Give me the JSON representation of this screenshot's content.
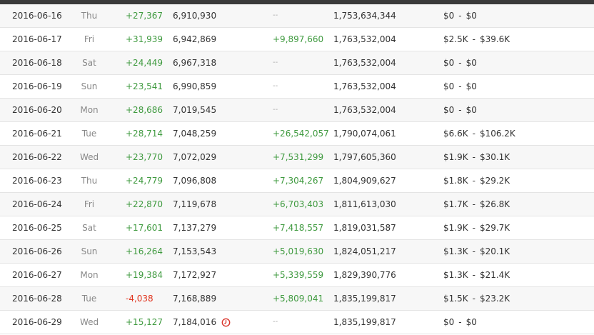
{
  "rows": [
    {
      "date": "2016-06-16",
      "day": "Thu",
      "sub_change": "+27,367",
      "sub_dir": "pos",
      "subs": "6,910,930",
      "warn": false,
      "view_change": "--",
      "view_dir": "none",
      "views": "1,753,634,344",
      "earnings_low": "$0",
      "earnings_high": "$0"
    },
    {
      "date": "2016-06-17",
      "day": "Fri",
      "sub_change": "+31,939",
      "sub_dir": "pos",
      "subs": "6,942,869",
      "warn": false,
      "view_change": "+9,897,660",
      "view_dir": "pos",
      "views": "1,763,532,004",
      "earnings_low": "$2.5K",
      "earnings_high": "$39.6K"
    },
    {
      "date": "2016-06-18",
      "day": "Sat",
      "sub_change": "+24,449",
      "sub_dir": "pos",
      "subs": "6,967,318",
      "warn": false,
      "view_change": "--",
      "view_dir": "none",
      "views": "1,763,532,004",
      "earnings_low": "$0",
      "earnings_high": "$0"
    },
    {
      "date": "2016-06-19",
      "day": "Sun",
      "sub_change": "+23,541",
      "sub_dir": "pos",
      "subs": "6,990,859",
      "warn": false,
      "view_change": "--",
      "view_dir": "none",
      "views": "1,763,532,004",
      "earnings_low": "$0",
      "earnings_high": "$0"
    },
    {
      "date": "2016-06-20",
      "day": "Mon",
      "sub_change": "+28,686",
      "sub_dir": "pos",
      "subs": "7,019,545",
      "warn": false,
      "view_change": "--",
      "view_dir": "none",
      "views": "1,763,532,004",
      "earnings_low": "$0",
      "earnings_high": "$0"
    },
    {
      "date": "2016-06-21",
      "day": "Tue",
      "sub_change": "+28,714",
      "sub_dir": "pos",
      "subs": "7,048,259",
      "warn": false,
      "view_change": "+26,542,057",
      "view_dir": "pos",
      "views": "1,790,074,061",
      "earnings_low": "$6.6K",
      "earnings_high": "$106.2K"
    },
    {
      "date": "2016-06-22",
      "day": "Wed",
      "sub_change": "+23,770",
      "sub_dir": "pos",
      "subs": "7,072,029",
      "warn": false,
      "view_change": "+7,531,299",
      "view_dir": "pos",
      "views": "1,797,605,360",
      "earnings_low": "$1.9K",
      "earnings_high": "$30.1K"
    },
    {
      "date": "2016-06-23",
      "day": "Thu",
      "sub_change": "+24,779",
      "sub_dir": "pos",
      "subs": "7,096,808",
      "warn": false,
      "view_change": "+7,304,267",
      "view_dir": "pos",
      "views": "1,804,909,627",
      "earnings_low": "$1.8K",
      "earnings_high": "$29.2K"
    },
    {
      "date": "2016-06-24",
      "day": "Fri",
      "sub_change": "+22,870",
      "sub_dir": "pos",
      "subs": "7,119,678",
      "warn": false,
      "view_change": "+6,703,403",
      "view_dir": "pos",
      "views": "1,811,613,030",
      "earnings_low": "$1.7K",
      "earnings_high": "$26.8K"
    },
    {
      "date": "2016-06-25",
      "day": "Sat",
      "sub_change": "+17,601",
      "sub_dir": "pos",
      "subs": "7,137,279",
      "warn": false,
      "view_change": "+7,418,557",
      "view_dir": "pos",
      "views": "1,819,031,587",
      "earnings_low": "$1.9K",
      "earnings_high": "$29.7K"
    },
    {
      "date": "2016-06-26",
      "day": "Sun",
      "sub_change": "+16,264",
      "sub_dir": "pos",
      "subs": "7,153,543",
      "warn": false,
      "view_change": "+5,019,630",
      "view_dir": "pos",
      "views": "1,824,051,217",
      "earnings_low": "$1.3K",
      "earnings_high": "$20.1K"
    },
    {
      "date": "2016-06-27",
      "day": "Mon",
      "sub_change": "+19,384",
      "sub_dir": "pos",
      "subs": "7,172,927",
      "warn": false,
      "view_change": "+5,339,559",
      "view_dir": "pos",
      "views": "1,829,390,776",
      "earnings_low": "$1.3K",
      "earnings_high": "$21.4K"
    },
    {
      "date": "2016-06-28",
      "day": "Tue",
      "sub_change": "-4,038",
      "sub_dir": "neg",
      "subs": "7,168,889",
      "warn": false,
      "view_change": "+5,809,041",
      "view_dir": "pos",
      "views": "1,835,199,817",
      "earnings_low": "$1.5K",
      "earnings_high": "$23.2K"
    },
    {
      "date": "2016-06-29",
      "day": "Wed",
      "sub_change": "+15,127",
      "sub_dir": "pos",
      "subs": "7,184,016",
      "warn": true,
      "view_change": "--",
      "view_dir": "none",
      "views": "1,835,199,817",
      "earnings_low": "$0",
      "earnings_high": "$0"
    }
  ],
  "earnings_separator": "-",
  "icons": {
    "warn": "clock-alert-icon"
  },
  "colors": {
    "positive": "#3f9a3f",
    "negative": "#e0341e",
    "warn": "#d9342b",
    "topbar": "#3a3a3a"
  }
}
